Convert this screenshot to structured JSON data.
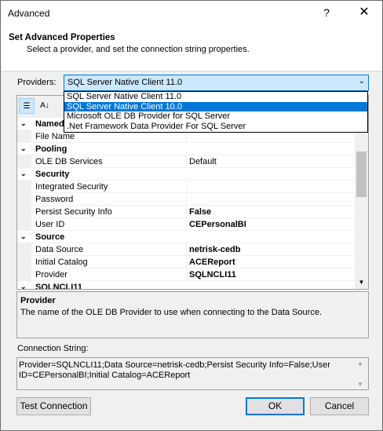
{
  "window": {
    "title": "Advanced",
    "help_glyph": "?",
    "close_glyph": "✕"
  },
  "header": {
    "title": "Set Advanced Properties",
    "subtitle": "Select a provider, and set the connection string properties."
  },
  "providers": {
    "label": "Providers:",
    "selected": "SQL Server Native Client 11.0",
    "options": [
      "SQL Server Native Client 11.0",
      "SQL Server Native Client 10.0",
      "Microsoft OLE DB Provider for SQL Server",
      ".Net Framework Data Provider For SQL Server"
    ],
    "highlighted_index": 1
  },
  "propgrid": {
    "rows": [
      {
        "type": "cat",
        "label": "Named"
      },
      {
        "type": "prop",
        "name": "File Name",
        "value": "",
        "bold": false
      },
      {
        "type": "cat",
        "label": "Pooling"
      },
      {
        "type": "prop",
        "name": "OLE DB Services",
        "value": "Default",
        "bold": false
      },
      {
        "type": "cat",
        "label": "Security"
      },
      {
        "type": "prop",
        "name": "Integrated Security",
        "value": "",
        "bold": false
      },
      {
        "type": "prop",
        "name": "Password",
        "value": "",
        "bold": false
      },
      {
        "type": "prop",
        "name": "Persist Security Info",
        "value": "False",
        "bold": true
      },
      {
        "type": "prop",
        "name": "User ID",
        "value": "CEPersonalBI",
        "bold": true
      },
      {
        "type": "cat",
        "label": "Source"
      },
      {
        "type": "prop",
        "name": "Data Source",
        "value": "netrisk-cedb",
        "bold": true
      },
      {
        "type": "prop",
        "name": "Initial Catalog",
        "value": "ACEReport",
        "bold": true
      },
      {
        "type": "prop",
        "name": "Provider",
        "value": "SQLNCLI11",
        "bold": true
      },
      {
        "type": "cat",
        "label": "SQLNCLI11"
      }
    ]
  },
  "description": {
    "title": "Provider",
    "text": "The name of the OLE DB Provider to use when connecting to the Data Source."
  },
  "connection": {
    "label": "Connection String:",
    "value": "Provider=SQLNCLI11;Data Source=netrisk-cedb;Persist Security Info=False;User ID=CEPersonalBI;Initial Catalog=ACEReport"
  },
  "buttons": {
    "test": "Test Connection",
    "ok": "OK",
    "cancel": "Cancel"
  }
}
